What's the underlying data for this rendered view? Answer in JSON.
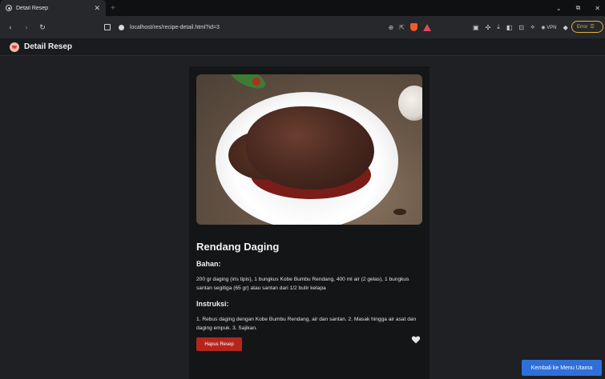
{
  "browser": {
    "tab_title": "Detail Resep",
    "url": "localhost/res/recipe-detail.html?id=3",
    "vpn_label": "VPN",
    "error_label": "Error"
  },
  "app": {
    "title": "Detail Resep"
  },
  "recipe": {
    "name": "Rendang Daging",
    "ingredients_heading": "Bahan:",
    "ingredients": "200 gr daging (iris tipis), 1 bungkus Kobe Bumbu Rendang, 400 ml air (2 gelas), 1 bungkus santan segitiga (65 gr) atau santan dari 1/2 butir kelapa",
    "instructions_heading": "Instruksi:",
    "instructions": "1. Rebus daging dengan Kobe Bumbu Rendang, air dan santan. 2. Masak hingga air asat dan daging empuk. 3. Sajikan.",
    "delete_label": "Hapus Resep"
  },
  "footer": {
    "back_label": "Kembali ke Menu Utama"
  },
  "icons": {
    "favorite": "heart-icon"
  },
  "colors": {
    "delete": "#b3261e",
    "back": "#2f6fd8",
    "background": "#1f2023",
    "card": "#141517"
  }
}
